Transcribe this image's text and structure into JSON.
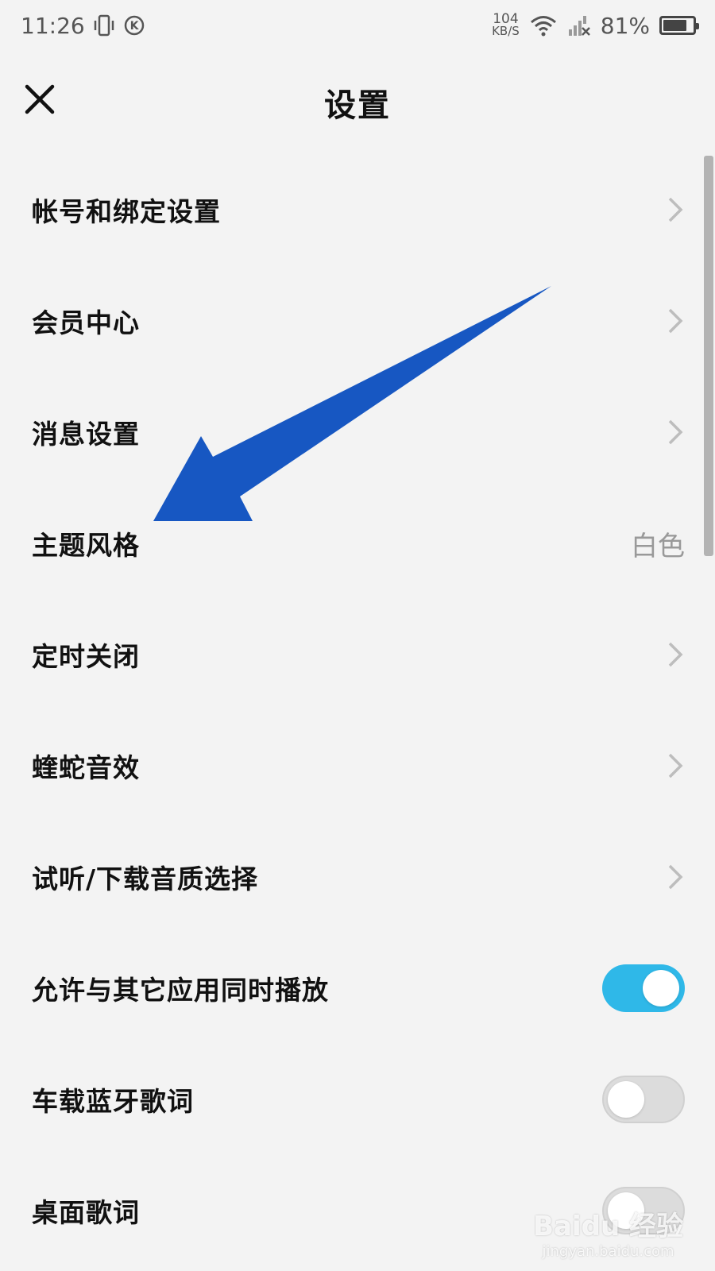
{
  "status_bar": {
    "time": "11:26",
    "vibrate_icon": "vibrate-icon",
    "app_icon": "k-circle-icon",
    "net_speed_value": "104",
    "net_speed_unit": "KB/S",
    "wifi_icon": "wifi-icon",
    "signal_icon": "signal-no-service-icon",
    "battery_text": "81%",
    "battery_level": 0.81
  },
  "header": {
    "title": "设置",
    "close_icon": "close-icon"
  },
  "settings": {
    "items": [
      {
        "label": "帐号和绑定设置",
        "type": "nav"
      },
      {
        "label": "会员中心",
        "type": "nav"
      },
      {
        "label": "消息设置",
        "type": "nav"
      },
      {
        "label": "主题风格",
        "type": "value",
        "value": "白色"
      },
      {
        "label": "定时关闭",
        "type": "nav"
      },
      {
        "label": "蝰蛇音效",
        "type": "nav"
      },
      {
        "label": "试听/下载音质选择",
        "type": "nav"
      },
      {
        "label": "允许与其它应用同时播放",
        "type": "toggle",
        "on": true
      },
      {
        "label": "车载蓝牙歌词",
        "type": "toggle",
        "on": false
      },
      {
        "label": "桌面歌词",
        "type": "toggle",
        "on": false
      }
    ]
  },
  "watermark": {
    "main": "Baidu 经验",
    "sub": "jingyan.baidu.com"
  },
  "colors": {
    "background": "#f3f3f3",
    "toggle_on": "#2fb8e8",
    "toggle_off": "#dcdcdc",
    "annotation_arrow": "#1757c2"
  }
}
